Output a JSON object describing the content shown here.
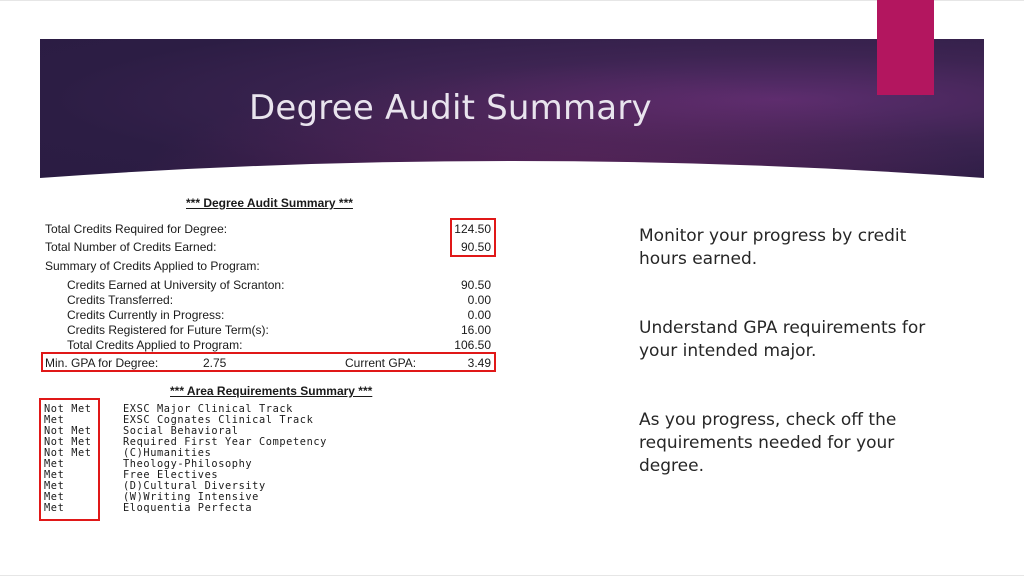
{
  "slide": {
    "title": "Degree Audit Summary",
    "colors": {
      "banner": "#2c1d44",
      "accent": "#b3165f",
      "highlight": "#e01818"
    }
  },
  "audit": {
    "heading": "*** Degree Audit Summary ***",
    "rows": [
      {
        "label": "Total Credits Required for Degree:",
        "value": "124.50"
      },
      {
        "label": "Total Number of Credits Earned:",
        "value": "90.50"
      },
      {
        "label": "Summary of Credits Applied to Program:",
        "value": ""
      }
    ],
    "sub_rows": [
      {
        "label": "Credits Earned at University of Scranton:",
        "value": "90.50"
      },
      {
        "label": "Credits Transferred:",
        "value": "0.00"
      },
      {
        "label": "Credits Currently in Progress:",
        "value": "0.00"
      },
      {
        "label": "Credits Registered for Future Term(s):",
        "value": "16.00"
      },
      {
        "label": "Total Credits Applied to Program:",
        "value": "106.50"
      }
    ],
    "gpa": {
      "min_label": "Min. GPA for Degree:",
      "min_value": "2.75",
      "current_label": "Current GPA:",
      "current_value": "3.49"
    }
  },
  "area": {
    "heading": "*** Area Requirements Summary ***",
    "requirements": [
      {
        "status": "Not Met",
        "name": "EXSC Major Clinical Track"
      },
      {
        "status": "Met",
        "name": "EXSC Cognates Clinical Track"
      },
      {
        "status": "Not Met",
        "name": "Social Behavioral"
      },
      {
        "status": "Not Met",
        "name": "Required First Year Competency"
      },
      {
        "status": "Not Met",
        "name": "(C)Humanities"
      },
      {
        "status": "Met",
        "name": "Theology-Philosophy"
      },
      {
        "status": "Met",
        "name": "Free Electives"
      },
      {
        "status": "Met",
        "name": "(D)Cultural Diversity"
      },
      {
        "status": "Met",
        "name": "(W)Writing Intensive"
      },
      {
        "status": "Met",
        "name": "Eloquentia Perfecta"
      }
    ]
  },
  "notes": [
    "Monitor your progress by credit hours earned.",
    "Understand GPA requirements for your intended major.",
    "As you progress, check off the requirements needed for your degree."
  ]
}
